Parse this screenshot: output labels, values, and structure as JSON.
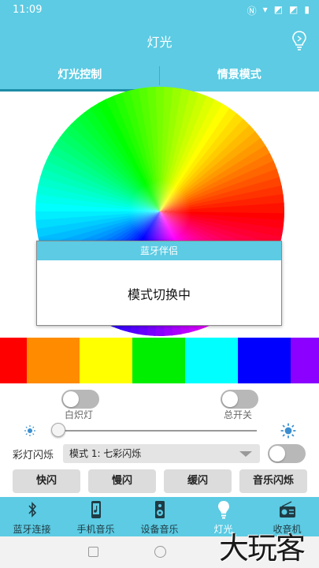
{
  "status_bar": {
    "time": "11:09",
    "icons": [
      "nfc-icon",
      "wifi-icon",
      "no-sim-icon",
      "no-sim-icon",
      "battery-icon"
    ]
  },
  "header": {
    "title": "灯光"
  },
  "tabs": [
    {
      "label": "灯光控制",
      "active": true
    },
    {
      "label": "情景模式",
      "active": false
    }
  ],
  "dialog": {
    "title": "蓝牙伴侣",
    "message": "模式切换中"
  },
  "color_strip": [
    "#ff0000",
    "#ff8c00",
    "#ffff00",
    "#00ee00",
    "#00ffff",
    "#0000ff",
    "#8b00ff"
  ],
  "toggles": {
    "white_light": {
      "label": "白炽灯",
      "on": false
    },
    "master_switch": {
      "label": "总开关",
      "on": false
    },
    "mode_toggle": {
      "on": false
    }
  },
  "brightness": {
    "value": 0
  },
  "mode": {
    "label": "彩灯闪烁",
    "selected": "模式 1: 七彩闪烁"
  },
  "buttons": {
    "fast": "快闪",
    "slow": "慢闪",
    "gentle": "缓闪",
    "music": "音乐闪烁"
  },
  "nav": [
    {
      "label": "蓝牙连接",
      "icon": "bluetooth-icon"
    },
    {
      "label": "手机音乐",
      "icon": "phone-music-icon"
    },
    {
      "label": "设备音乐",
      "icon": "speaker-icon"
    },
    {
      "label": "灯光",
      "icon": "bulb-icon",
      "active": true
    },
    {
      "label": "收音机",
      "icon": "radio-icon"
    }
  ],
  "watermark": "大玩客",
  "colors": {
    "accent": "#5ccbe3"
  }
}
